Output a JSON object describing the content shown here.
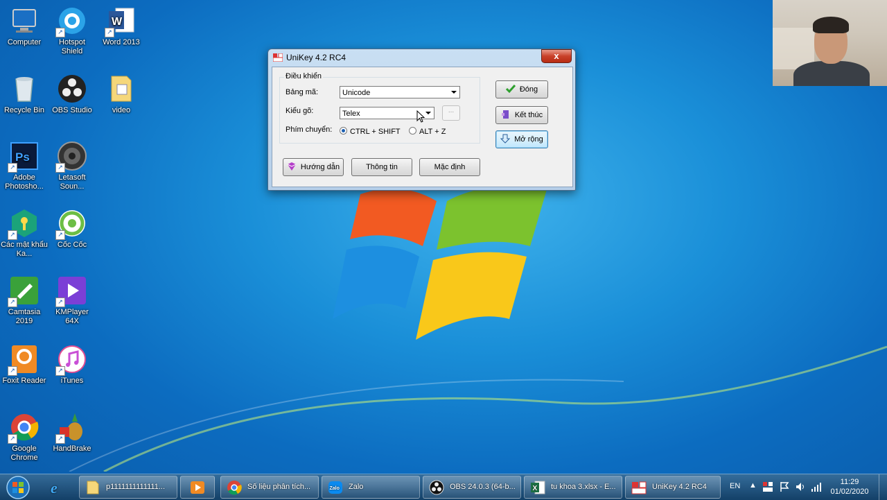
{
  "desktop": {
    "icons": [
      {
        "label": "Computer",
        "icon": "computer-icon"
      },
      {
        "label": "Hotspot Shield",
        "icon": "hotspot-shield-icon"
      },
      {
        "label": "Word 2013",
        "icon": "word-icon"
      },
      {
        "label": "Recycle Bin",
        "icon": "recycle-bin-icon"
      },
      {
        "label": "OBS Studio",
        "icon": "obs-icon"
      },
      {
        "label": "video",
        "icon": "folder-icon"
      },
      {
        "label": "Adobe Photosho...",
        "icon": "photoshop-icon"
      },
      {
        "label": "Letasoft Soun...",
        "icon": "speaker-icon"
      },
      {
        "label": "Các mật khẩu Ka...",
        "icon": "kaspersky-icon"
      },
      {
        "label": "Cốc Cốc",
        "icon": "coccoc-icon"
      },
      {
        "label": "Camtasia 2019",
        "icon": "camtasia-icon"
      },
      {
        "label": "KMPlayer 64X",
        "icon": "kmplayer-icon"
      },
      {
        "label": "Foxit Reader",
        "icon": "foxit-icon"
      },
      {
        "label": "iTunes",
        "icon": "itunes-icon"
      },
      {
        "label": "Google Chrome",
        "icon": "chrome-icon"
      },
      {
        "label": "HandBrake",
        "icon": "handbrake-icon"
      }
    ]
  },
  "unikey": {
    "title": "UniKey 4.2 RC4",
    "close_label": "x",
    "group_label": "Điều khiển",
    "charset_label": "Bảng mã:",
    "charset_value": "Unicode",
    "input_label": "Kiểu gõ:",
    "input_value": "Telex",
    "more_label": "...",
    "switch_label": "Phím chuyển:",
    "switch_opt1": "CTRL + SHIFT",
    "switch_opt2": "ALT + Z",
    "btn_close": "Đóng",
    "btn_exit": "Kết thúc",
    "btn_expand": "Mở rộng",
    "btn_help": "Hướng dẫn",
    "btn_info": "Thông tin",
    "btn_default": "Mặc định"
  },
  "taskbar": {
    "items": [
      {
        "label": "p1111111111111...",
        "icon": "folder-icon"
      },
      {
        "label": "",
        "icon": "media-player-icon"
      },
      {
        "label": "Số liệu phân tích...",
        "icon": "chrome-icon"
      },
      {
        "label": "Zalo",
        "icon": "zalo-icon"
      },
      {
        "label": "OBS 24.0.3 (64-b...",
        "icon": "obs-icon"
      },
      {
        "label": "tu khoa 3.xlsx - E...",
        "icon": "excel-icon"
      },
      {
        "label": "UniKey 4.2 RC4",
        "icon": "unikey-icon"
      }
    ],
    "lang": "EN",
    "time": "11:29",
    "date": "01/02/2020"
  }
}
